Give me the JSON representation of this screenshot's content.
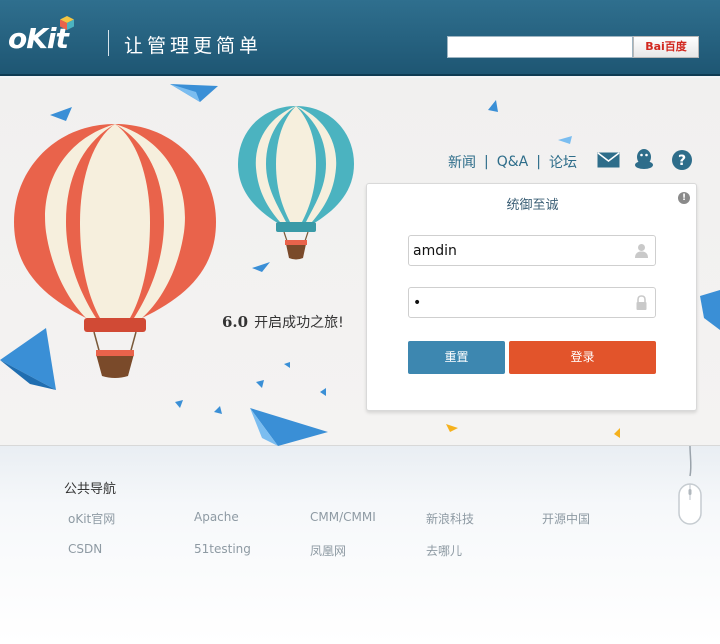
{
  "header": {
    "logo": "oKit",
    "slogan": "让管理更简单",
    "search": {
      "value": "",
      "placeholder": ""
    },
    "search_button": {
      "brand_a": "Bai",
      "brand_b": "百度"
    }
  },
  "hero": {
    "version": "6.0",
    "tagline": "开启成功之旅!"
  },
  "topnav": {
    "items": [
      "新闻",
      "Q&A",
      "论坛"
    ],
    "separator": "|",
    "icons": [
      "mail-icon",
      "qq-icon",
      "help-icon"
    ]
  },
  "login": {
    "title": "统御至诚",
    "info_icon": "!",
    "username": {
      "value": "amdin",
      "icon": "user-icon"
    },
    "password": {
      "value": "•",
      "icon": "lock-icon"
    },
    "reset_label": "重置",
    "login_label": "登录"
  },
  "links": {
    "title": "公共导航",
    "rows": [
      [
        "oKit官网",
        "Apache",
        "CMM/CMMI",
        "新浪科技",
        "开源中国"
      ],
      [
        "CSDN",
        "51testing",
        "凤凰网",
        "去哪儿"
      ]
    ]
  },
  "colors": {
    "header": "#2a6683",
    "reset_button": "#3d87b0",
    "login_button": "#e2542b",
    "balloon_red": "#e9634b",
    "balloon_teal": "#4bb3c0"
  }
}
